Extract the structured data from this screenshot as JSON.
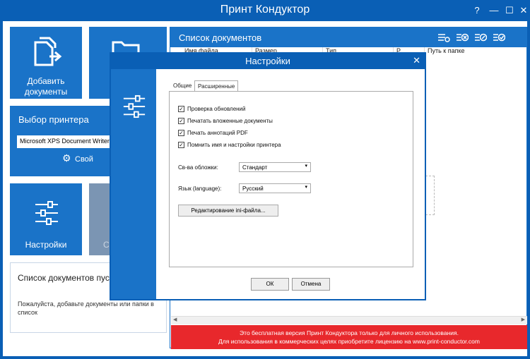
{
  "window": {
    "title": "Принт Кондуктор",
    "controls": {
      "help": "?",
      "minimize": "—",
      "maximize": "☐",
      "close": "✕"
    }
  },
  "tiles": {
    "add_documents": "Добавить документы",
    "add_folder_icon": "folder-icon",
    "settings": "Настройки",
    "grey_partial": "С"
  },
  "printer": {
    "title": "Выбор принтера",
    "selected": "Microsoft XPS Document Writer",
    "properties": "Свой"
  },
  "empty_list": {
    "title": "Список документов пуст",
    "hint": "Пожалуйста, добавьте документы или папки в список"
  },
  "doclist": {
    "title": "Список документов",
    "columns": [
      "Имя файла",
      "Размер",
      "Тип",
      "Р",
      "Путь к папке"
    ]
  },
  "banner": {
    "line1": "Это бесплатная версия Принт Кондуктора только для личного использования.",
    "line2": "Для использования в коммерческих целях приобретите лицензию на www.print-conductor.com"
  },
  "settings_dialog": {
    "title": "Настройки",
    "close": "✕",
    "tabs": [
      "Общие",
      "Расширенные"
    ],
    "active_tab": "Расширенные",
    "checkboxes": [
      {
        "label": "Проверка обновлений",
        "checked": true
      },
      {
        "label": "Печатать вложенные документы",
        "checked": true
      },
      {
        "label": "Печать аннотаций PDF",
        "checked": true
      },
      {
        "label": "Помнить имя и настройки принтера",
        "checked": true
      }
    ],
    "cover_label": "Св-ва обложки:",
    "cover_value": "Стандарт",
    "language_label": "Язык (language):",
    "language_value": "Русский",
    "edit_ini": "Редактирование ini-файла...",
    "ok": "ОК",
    "cancel": "Отмена"
  }
}
